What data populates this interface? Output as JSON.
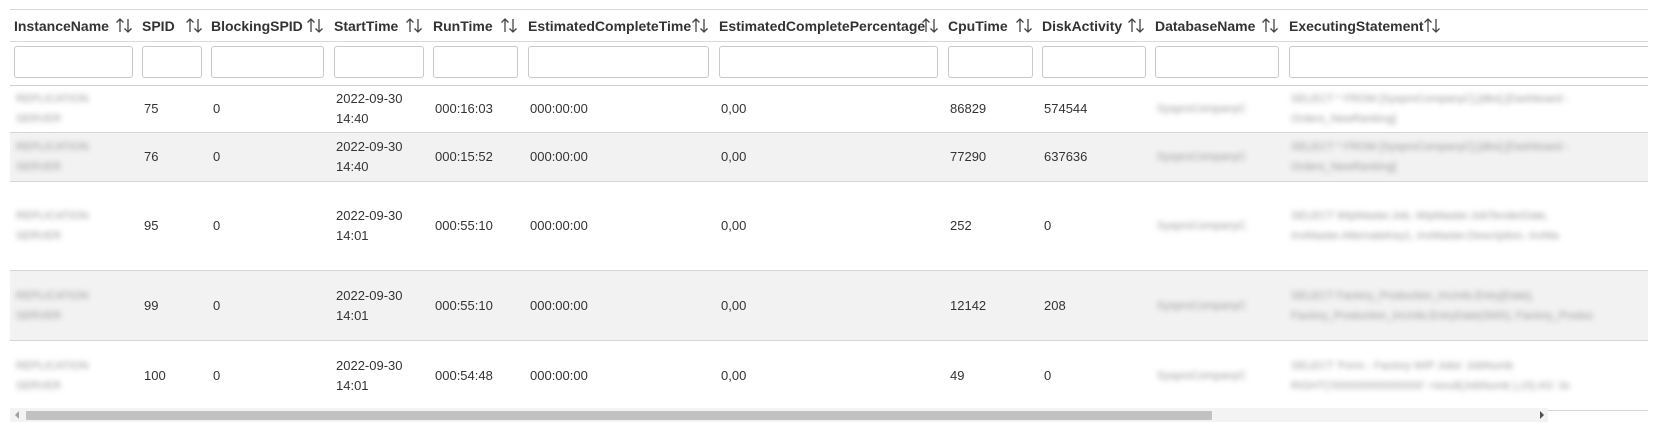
{
  "columns": [
    {
      "key": "instance",
      "label": "InstanceName"
    },
    {
      "key": "spid",
      "label": "SPID"
    },
    {
      "key": "blocking",
      "label": "BlockingSPID"
    },
    {
      "key": "start",
      "label": "StartTime"
    },
    {
      "key": "run",
      "label": "RunTime"
    },
    {
      "key": "est_time",
      "label": "EstimatedCompleteTime"
    },
    {
      "key": "est_pct",
      "label": "EstimatedCompletePercentage"
    },
    {
      "key": "cpu",
      "label": "CpuTime"
    },
    {
      "key": "disk",
      "label": "DiskActivity"
    },
    {
      "key": "db",
      "label": "DatabaseName"
    },
    {
      "key": "stmt",
      "label": "ExecutingStatement"
    }
  ],
  "icons": {
    "sort": "sort-arrows-icon",
    "scroll_left": "chevron-left-icon",
    "scroll_right": "chevron-right-icon"
  },
  "rows": [
    {
      "instance": "REPLICATION SERVER",
      "spid": "75",
      "blocking": "0",
      "start": "2022-09-30 14:40",
      "run": "000:16:03",
      "est_time": "000:00:00",
      "est_pct": "0,00",
      "cpu": "86829",
      "disk": "574544",
      "db": "SysproCompanyC",
      "stmt": "SELECT * FROM [SysproCompanyC].[dbo].[Dashboard - Orders_NewRanking]"
    },
    {
      "instance": "REPLICATION SERVER",
      "spid": "76",
      "blocking": "0",
      "start": "2022-09-30 14:40",
      "run": "000:15:52",
      "est_time": "000:00:00",
      "est_pct": "0,00",
      "cpu": "77290",
      "disk": "637636",
      "db": "SysproCompanyC",
      "stmt": "SELECT * FROM [SysproCompanyC].[dbo].[Dashboard - Orders_NewRanking]"
    },
    {
      "instance": "REPLICATION SERVER",
      "spid": "95",
      "blocking": "0",
      "start": "2022-09-30 14:01",
      "run": "000:55:10",
      "est_time": "000:00:00",
      "est_pct": "0,00",
      "cpu": "252",
      "disk": "0",
      "db": "SysproCompanyC",
      "stmt": "SELECT WipMaster.Job, WipMaster.JobTenderDate, InvMaster.AlternateKey1, InvMaster.Description, InvMa"
    },
    {
      "instance": "REPLICATION SERVER",
      "spid": "99",
      "blocking": "0",
      "start": "2022-09-30 14:01",
      "run": "000:55:10",
      "est_time": "000:00:00",
      "est_pct": "0,00",
      "cpu": "12142",
      "disk": "208",
      "db": "SysproCompanyC",
      "stmt": "SELECT Factory_Production_InUnits.Entry[Date], Factory_Production_InUnits.EntryDate(SMS), Factory_Produc"
    },
    {
      "instance": "REPLICATION SERVER",
      "spid": "100",
      "blocking": "0",
      "start": "2022-09-30 14:01",
      "run": "000:54:48",
      "est_time": "000:00:00",
      "est_pct": "0,00",
      "cpu": "49",
      "disk": "0",
      "db": "SysproCompanyC",
      "stmt": "SELECT 'Form - Factory WIP Jobs' JobNumb RIGHT('000000000000000' +isnull(JobNumb ),15) AS 'Jo"
    }
  ]
}
